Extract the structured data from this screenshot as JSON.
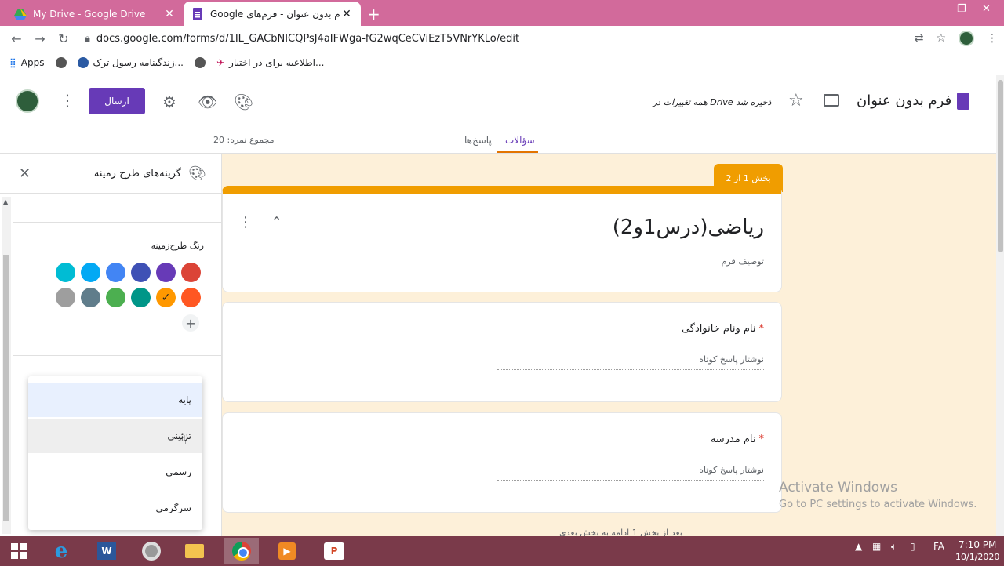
{
  "browser": {
    "tabs": [
      {
        "title": "My Drive - Google Drive",
        "active": false
      },
      {
        "title": "Google فرم بدون عنوان - فرم‌های",
        "active": true
      }
    ],
    "url": "docs.google.com/forms/d/1IL_GACbNICQPsJ4aIFWga-fG2wqCeCViEzT5VNrYKLo/edit",
    "bookmarks": [
      {
        "label": "Apps"
      },
      {
        "label": "زندگینامه رسول ترک..."
      },
      {
        "label": "اطلاعیه برای در اختیار..."
      }
    ]
  },
  "header": {
    "title": "فرم بدون عنوان",
    "saved_message": "همه تغییرات در Drive ذخیره شد",
    "send_label": "ارسال",
    "total_points": "مجموع نمره: 20",
    "tabs": {
      "questions": "سؤالات",
      "responses": "پاسخ‌ها"
    }
  },
  "theme_panel": {
    "title": "گزینه‌های طرح زمینه",
    "theme_color_label": "رنگ طرح‌زمینه",
    "colors_row1": [
      "#db4437",
      "#673ab7",
      "#3f51b5",
      "#4285f4",
      "#03a9f4",
      "#00bcd4"
    ],
    "colors_row2": [
      "#ff5722",
      "#ff9800",
      "#009688",
      "#4caf50",
      "#607d8b",
      "#9e9e9e"
    ],
    "selected_color": "#ff9800",
    "font_options": [
      {
        "label": "پایه",
        "state": "selected"
      },
      {
        "label": "تزئینی",
        "state": "hover"
      },
      {
        "label": "رسمی",
        "state": "normal"
      },
      {
        "label": "سرگرمی",
        "state": "normal"
      }
    ]
  },
  "form": {
    "section_label": "بخش 1 از 2",
    "title": "ریاضی(درس1و2)",
    "description": "توصیف فرم",
    "questions": [
      {
        "label": "نام ونام خانوادگی",
        "placeholder": "نوشتار پاسخ کوتاه"
      },
      {
        "label": "نام مدرسه",
        "placeholder": "نوشتار پاسخ کوتاه"
      }
    ],
    "after_section": "بعد از بخش 1    ادامه به بخش بعدی"
  },
  "watermark": {
    "title": "Activate Windows",
    "subtitle": "Go to PC settings to activate Windows."
  },
  "taskbar": {
    "time": "7:10 PM",
    "date": "10/1/2020",
    "language": "FA"
  },
  "colors": {
    "accent": "#673ab7",
    "theme": "#ff9800",
    "background": "#fdf0d9"
  }
}
